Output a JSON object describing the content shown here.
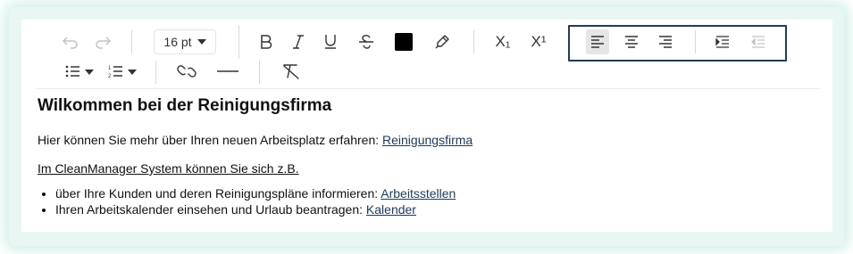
{
  "toolbar": {
    "font_size": "16 pt",
    "subscript_label": "X₁",
    "superscript_label": "X¹",
    "text_color": "#000000",
    "alignment_active": "left"
  },
  "content": {
    "heading": "Wilkommen bei der Reinigungsfirma",
    "intro_text": "Hier können Sie mehr über Ihren neuen Arbeitsplatz erfahren: ",
    "intro_link": "Reinigungsfirma",
    "system_text": "Im CleanManager System können Sie sich z.B.",
    "list": [
      {
        "text": "über Ihre Kunden und deren Reinigungspläne informieren: ",
        "link": "Arbeitsstellen"
      },
      {
        "text": "Ihren Arbeitskalender einsehen und Urlaub beantragen: ",
        "link": "Kalender"
      }
    ]
  },
  "colors": {
    "link": "#1c3a57",
    "highlight_border": "#243a55",
    "glow": "#d3f1ea"
  }
}
